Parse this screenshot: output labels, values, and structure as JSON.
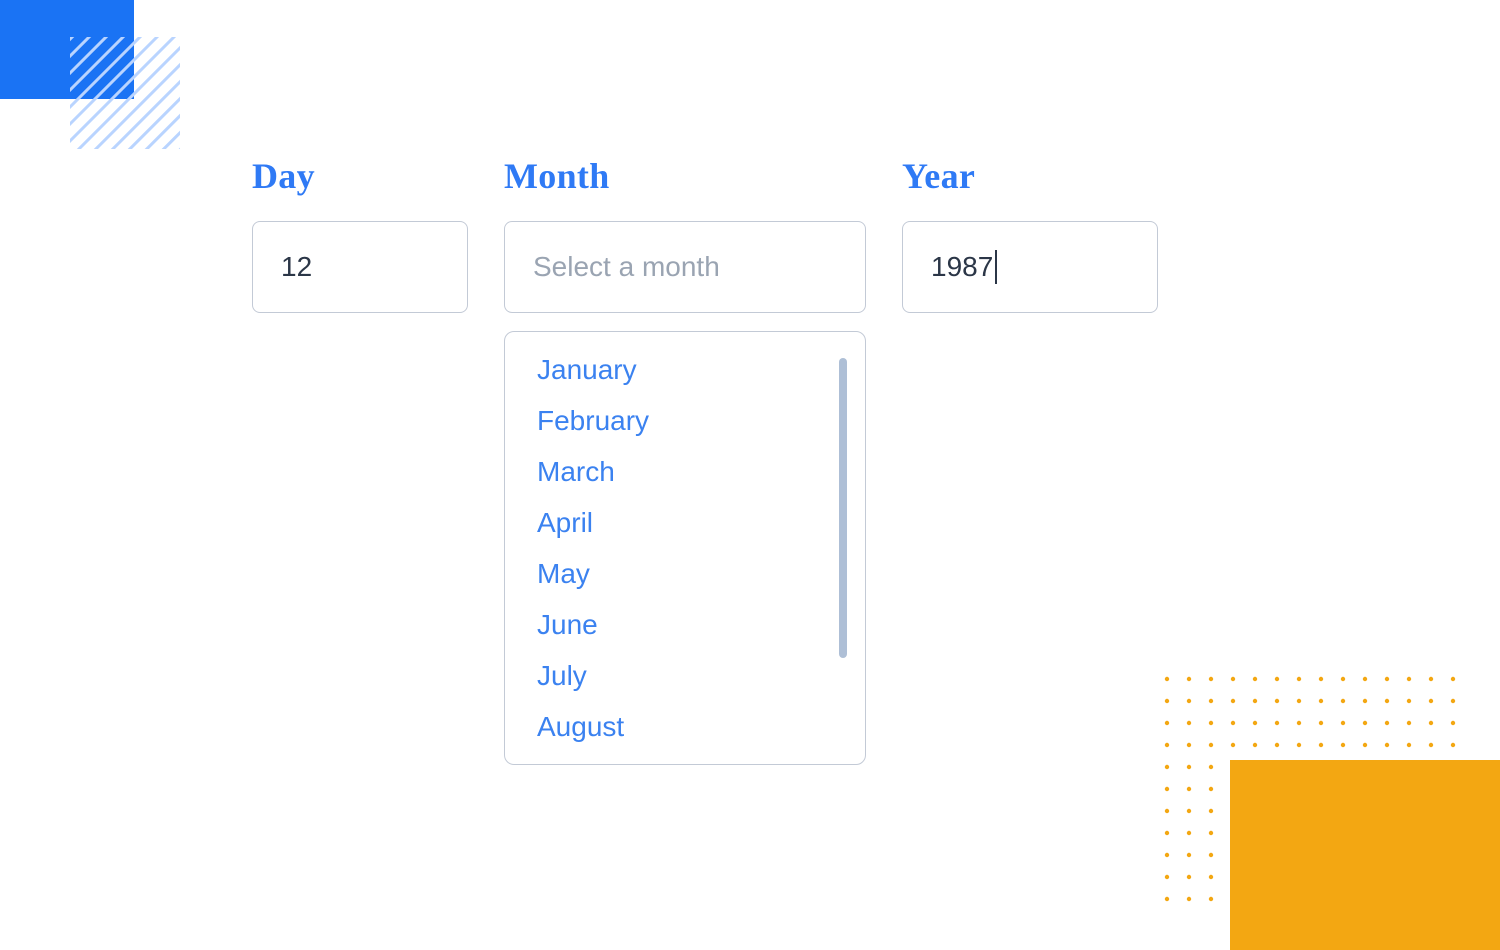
{
  "labels": {
    "day": "Day",
    "month": "Month",
    "year": "Year"
  },
  "values": {
    "day": "12",
    "month_placeholder": "Select a month",
    "year": "1987"
  },
  "month_options": [
    "January",
    "February",
    "March",
    "April",
    "May",
    "June",
    "July",
    "August"
  ],
  "colors": {
    "accent_blue": "#2f7af5",
    "accent_yellow": "#f3a712",
    "border": "#c3cad6",
    "text": "#2b3647",
    "placeholder": "#9aa4b2"
  }
}
